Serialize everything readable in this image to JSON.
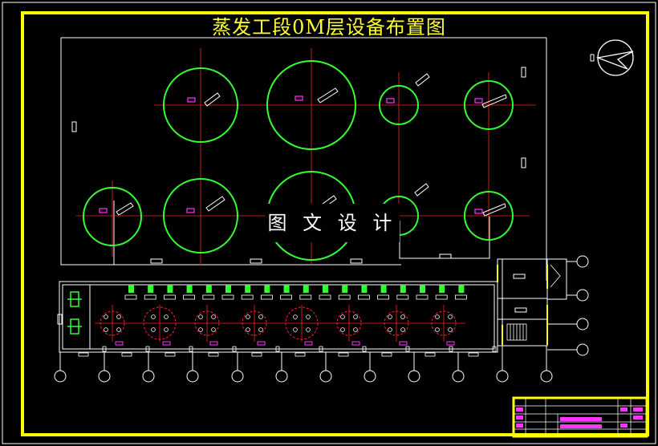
{
  "drawing": {
    "title": "蒸发工段0M层设备布置图",
    "watermark_text": "图 文 设 计"
  },
  "colors": {
    "frame": "#ffff00",
    "tank": "#33ff33",
    "centerline": "#ff2222",
    "wall": "#ffffff",
    "marker": "#ff33ff",
    "pump": "#33ff33"
  },
  "equipment": {
    "large_tanks_upper_row": 4,
    "large_tanks_lower_row": 4,
    "pumps": 18,
    "small_vessels": 8,
    "column_grid_markers_bottom": 12,
    "column_grid_markers_right": 4
  }
}
